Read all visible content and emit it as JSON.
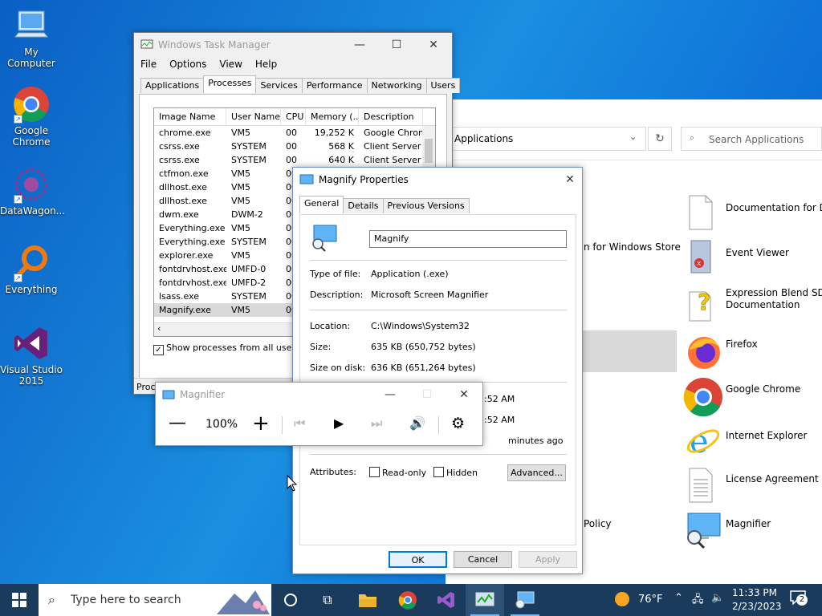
{
  "desktop": {
    "icons": [
      {
        "label": "My Computer"
      },
      {
        "label": "Google Chrome"
      },
      {
        "label": "DataWagon..."
      },
      {
        "label": "Everything"
      },
      {
        "label": "Visual Studio 2015"
      }
    ]
  },
  "task_manager": {
    "title": "Windows Task Manager",
    "menu": [
      "File",
      "Options",
      "View",
      "Help"
    ],
    "tabs": [
      "Applications",
      "Processes",
      "Services",
      "Performance",
      "Networking",
      "Users"
    ],
    "columns": [
      "Image Name",
      "User Name",
      "CPU",
      "Memory (...",
      "Description"
    ],
    "rows": [
      [
        "chrome.exe",
        "VM5",
        "00",
        "19,252 K",
        "Google Chrome"
      ],
      [
        "csrss.exe",
        "SYSTEM",
        "00",
        "568 K",
        "Client Server R"
      ],
      [
        "csrss.exe",
        "SYSTEM",
        "00",
        "640 K",
        "Client Server R"
      ],
      [
        "ctfmon.exe",
        "VM5",
        "00",
        "",
        ""
      ],
      [
        "dllhost.exe",
        "VM5",
        "00",
        "",
        ""
      ],
      [
        "dllhost.exe",
        "VM5",
        "00",
        "",
        ""
      ],
      [
        "dwm.exe",
        "DWM-2",
        "00",
        "",
        ""
      ],
      [
        "Everything.exe",
        "VM5",
        "00",
        "",
        ""
      ],
      [
        "Everything.exe",
        "SYSTEM",
        "00",
        "",
        ""
      ],
      [
        "explorer.exe",
        "VM5",
        "00",
        "",
        ""
      ],
      [
        "fontdrvhost.exe",
        "UMFD-0",
        "00",
        "",
        ""
      ],
      [
        "fontdrvhost.exe",
        "UMFD-2",
        "00",
        "",
        ""
      ],
      [
        "lsass.exe",
        "SYSTEM",
        "00",
        "",
        ""
      ],
      [
        "Magnify.exe",
        "VM5",
        "00",
        "",
        ""
      ]
    ],
    "show_all_label": "Show processes from all users",
    "status_text": "Proc"
  },
  "explorer": {
    "address": "Applications",
    "search_placeholder": "Search Applications",
    "partial_items": [
      "n for Windows Store",
      "Policy"
    ],
    "items": [
      {
        "label": "Documentation for De"
      },
      {
        "label": "Event Viewer"
      },
      {
        "label": "Expression Blend SDK Documentation"
      },
      {
        "label": "Firefox"
      },
      {
        "label": "Google Chrome"
      },
      {
        "label": "Internet Explorer"
      },
      {
        "label": "License Agreement"
      },
      {
        "label": "Magnifier"
      }
    ]
  },
  "properties": {
    "title": "Magnify Properties",
    "tabs": [
      "General",
      "Details",
      "Previous Versions"
    ],
    "name_value": "Magnify",
    "type_label": "Type of file:",
    "type_value": "Application (.exe)",
    "desc_label": "Description:",
    "desc_value": "Microsoft Screen Magnifier",
    "location_label": "Location:",
    "location_value": "C:\\Windows\\System32",
    "size_label": "Size:",
    "size_value": "635 KB (650,752 bytes)",
    "sizedisk_label": "Size on disk:",
    "sizedisk_value": "636 KB (651,264 bytes)",
    "time1": ":52 AM",
    "time2": ":52 AM",
    "time3": "minutes ago",
    "attributes_label": "Attributes:",
    "readonly_label": "Read-only",
    "hidden_label": "Hidden",
    "advanced_label": "Advanced...",
    "ok_label": "OK",
    "cancel_label": "Cancel",
    "apply_label": "Apply"
  },
  "magnifier": {
    "title": "Magnifier",
    "zoom": "100%"
  },
  "taskbar": {
    "search_placeholder": "Type here to search",
    "weather": "76°F",
    "time": "11:33 PM",
    "date": "2/23/2023",
    "notification_count": "2"
  },
  "colors": {
    "accent": "#0078d7",
    "taskbar": "#1a3b5c",
    "selection": "#cce8ff"
  }
}
